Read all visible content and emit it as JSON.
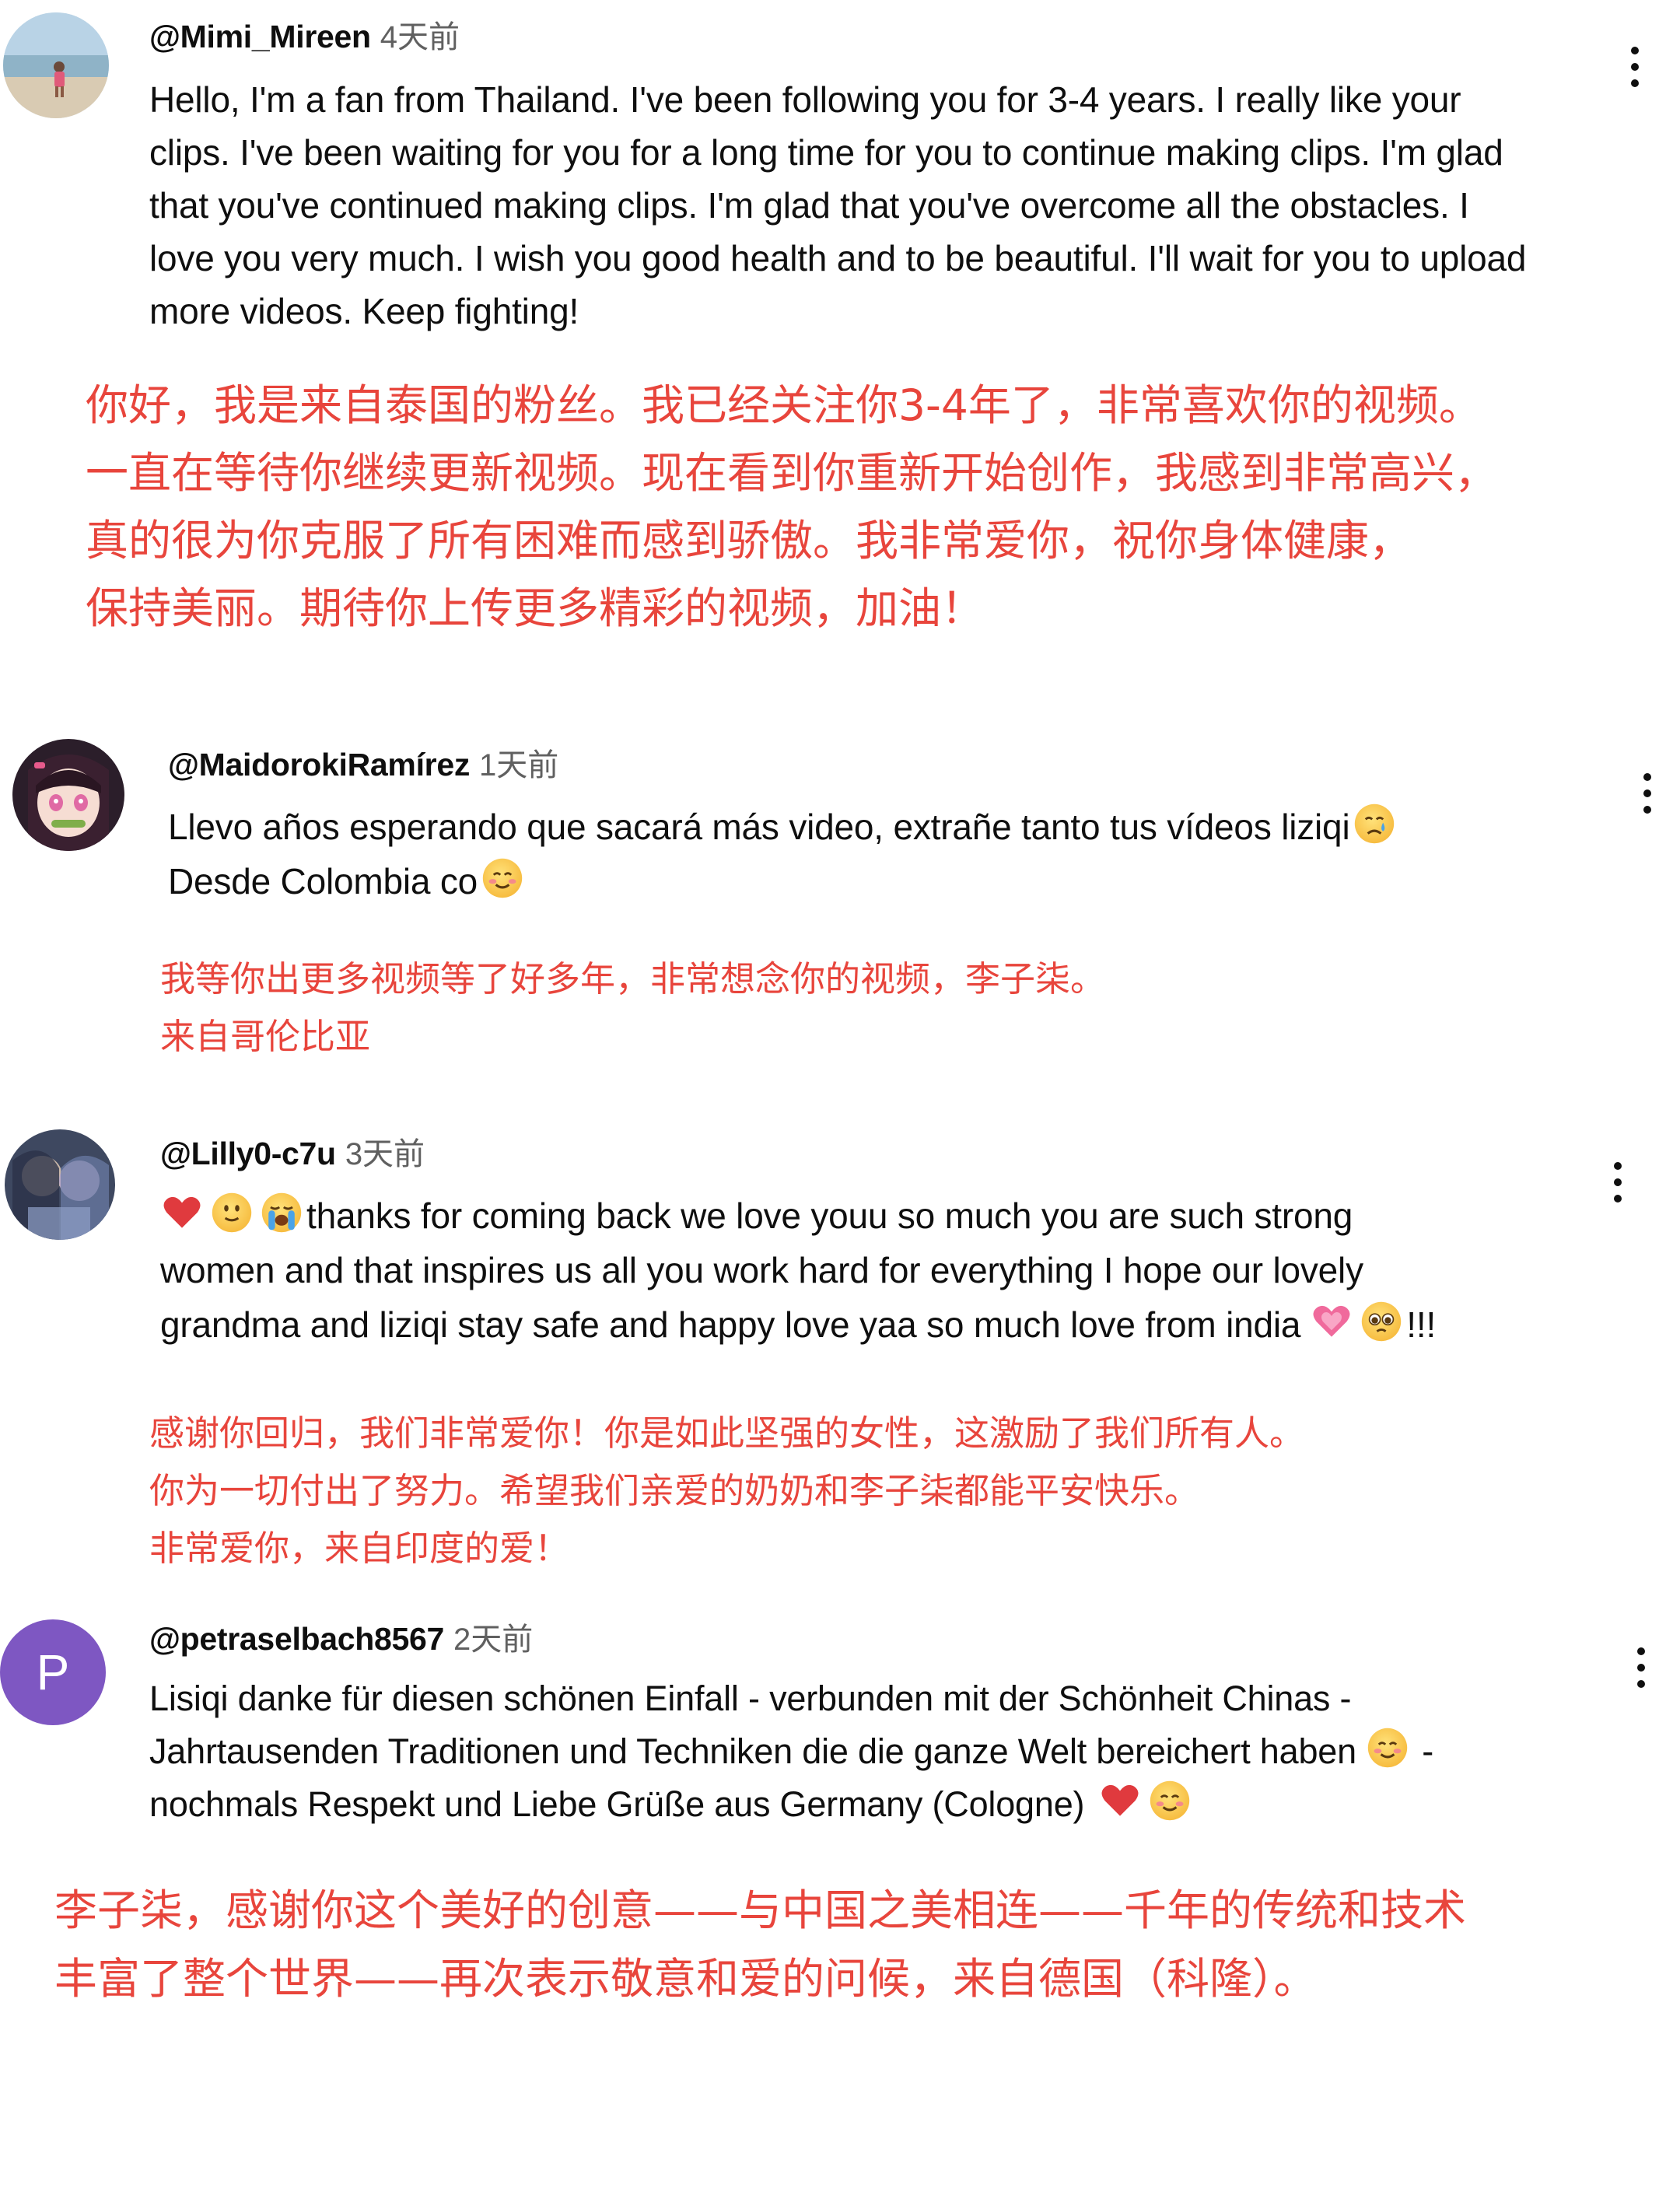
{
  "comments": [
    {
      "username": "@Mimi_Mireen",
      "timestamp": "4天前",
      "body_lines": [
        "Hello, I'm a fan from Thailand. I've been following you for 3-4 years. I really like your",
        "clips. I've been waiting for you for a long time for you to continue making clips. I'm glad",
        "that you've continued making clips. I'm glad that you've overcome all the obstacles. I",
        "love you very much. I wish you good health and to be beautiful. I'll wait for you to upload",
        "more videos. Keep fighting!"
      ],
      "translation_lines": [
        "你好，我是来自泰国的粉丝。我已经关注你3-4年了，非常喜欢你的视频。",
        "一直在等待你继续更新视频。现在看到你重新开始创作，我感到非常高兴，",
        "真的很为你克服了所有困难而感到骄傲。我非常爱你，祝你身体健康，",
        "保持美丽。期待你上传更多精彩的视频，加油！"
      ]
    },
    {
      "username": "@MaidorokiRamírez",
      "timestamp": "1天前",
      "body_line1": "Llevo años esperando que sacará más video, extrañe tanto tus vídeos liziqi",
      "body_line2": "Desde Colombia co",
      "translation_lines": [
        "我等你出更多视频等了好多年，非常想念你的视频，李子柒。",
        "来自哥伦比亚"
      ]
    },
    {
      "username": "@Lilly0-c7u",
      "timestamp": "3天前",
      "body_line1": "thanks for coming back we love youu so much you are such strong",
      "body_line2": "women and that inspires us all you work hard for everything I hope our lovely",
      "body_line3": "grandma and liziqi stay safe and happy love yaa so much love from india",
      "body_line3_end": "!!!",
      "translation_lines": [
        "感谢你回归，我们非常爱你！你是如此坚强的女性，这激励了我们所有人。",
        "你为一切付出了努力。希望我们亲爱的奶奶和李子柒都能平安快乐。",
        "非常爱你，来自印度的爱！"
      ]
    },
    {
      "username": "@petraselbach8567",
      "timestamp": "2天前",
      "avatar_letter": "P",
      "body_line1": "Lisiqi danke für diesen schönen Einfall - verbunden mit der Schönheit Chinas -",
      "body_line2": "Jahrtausenden Traditionen und Techniken die die ganze Welt bereichert haben",
      "body_line2_end": "-",
      "body_line3": "nochmals Respekt und Liebe Grüße aus Germany (Cologne)",
      "translation_lines": [
        "李子柒，感谢你这个美好的创意——与中国之美相连——千年的传统和技术",
        "丰富了整个世界——再次表示敬意和爱的问候，来自德国（科隆）。"
      ]
    }
  ],
  "icons": {
    "more": "more-vert-icon",
    "emojis": [
      "crying-face-emoji",
      "smiling-face-emoji",
      "red-heart-emoji",
      "slightly-smiling-face-emoji",
      "loudly-crying-face-emoji",
      "growing-heart-emoji",
      "pleading-face-emoji"
    ]
  },
  "colors": {
    "translation": "#e8453c",
    "username": "#0f0f0f",
    "timestamp": "#606060",
    "avatar_p": "#7e57c2"
  }
}
